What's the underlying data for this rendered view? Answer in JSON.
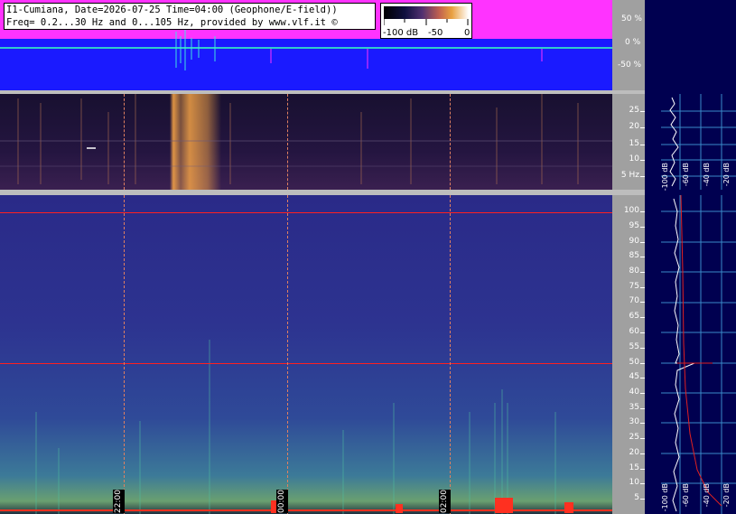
{
  "header": {
    "line1": "I1-Cumiana, Date=2026-07-25 Time=04:00 (Geophone/E-field))",
    "line2": "Freq= 0.2...30 Hz and 0...105 Hz, provided by www.vlf.it ©"
  },
  "colorbar": {
    "labels": [
      "-100 dB",
      "-50",
      "0"
    ]
  },
  "waveform_axis": {
    "labels": [
      "50 %",
      "0 %",
      "-50 %"
    ]
  },
  "lowfreq_axis": {
    "labels": [
      "25",
      "20",
      "15",
      "10",
      "5 Hz"
    ]
  },
  "highfreq_axis": {
    "labels": [
      "100",
      "95",
      "90",
      "85",
      "80",
      "75",
      "70",
      "65",
      "60",
      "55",
      "50",
      "45",
      "40",
      "35",
      "30",
      "25",
      "20",
      "15",
      "10",
      "5"
    ]
  },
  "time_markers": [
    "22:00",
    "00:00",
    "02:00"
  ],
  "side_panel": {
    "top_db_labels": [
      "-100 dB",
      "-60 dB",
      "-40 dB",
      "-20 dB"
    ],
    "bottom_db_labels": [
      "-100 dB",
      "-60 dB",
      "-40 dB",
      "-20 dB"
    ]
  },
  "colors": {
    "waveform_bg": "#1a1aff",
    "waveform_envelope": "#ff33ff",
    "spectrogram_low": "#181030",
    "spectrogram_high": "#2a2a88",
    "side_panel_bg": "#000050",
    "marker_line": "#ff2020"
  }
}
